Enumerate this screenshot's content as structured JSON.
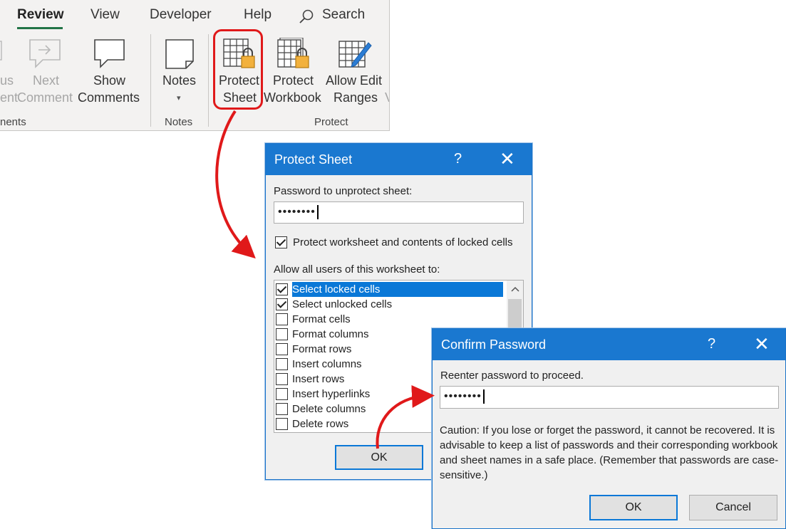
{
  "ribbon": {
    "tabs": [
      {
        "label": "Review",
        "active": true
      },
      {
        "label": "View"
      },
      {
        "label": "Developer"
      },
      {
        "label": "Help"
      }
    ],
    "search_label": "Search",
    "buttons": {
      "previous_label_1": "us",
      "previous_label_2": "ent",
      "next_label_1": "Next",
      "next_label_2": "Comment",
      "show_comments_label_1": "Show",
      "show_comments_label_2": "Comments",
      "notes_label": "Notes",
      "protect_sheet_label_1": "Protect",
      "protect_sheet_label_2": "Sheet",
      "protect_workbook_label_1": "Protect",
      "protect_workbook_label_2": "Workbook",
      "allow_edit_label_1": "Allow Edit",
      "allow_edit_label_2": "Ranges",
      "cut_off_label": "V"
    },
    "groups": {
      "comments": "nents",
      "notes": "Notes",
      "protect": "Protect"
    },
    "accent_color": "#217346"
  },
  "protect_sheet_dialog": {
    "title": "Protect Sheet",
    "help": "?",
    "close": "✕",
    "password_label": "Password to unprotect sheet:",
    "password_value": "••••••••",
    "protect_checkbox_label": "Protect worksheet and contents of locked cells",
    "protect_checkbox_checked": true,
    "allow_label": "Allow all users of this worksheet to:",
    "permissions": [
      {
        "label": "Select locked cells",
        "checked": true,
        "selected": true
      },
      {
        "label": "Select unlocked cells",
        "checked": true
      },
      {
        "label": "Format cells",
        "checked": false
      },
      {
        "label": "Format columns",
        "checked": false
      },
      {
        "label": "Format rows",
        "checked": false
      },
      {
        "label": "Insert columns",
        "checked": false
      },
      {
        "label": "Insert rows",
        "checked": false
      },
      {
        "label": "Insert hyperlinks",
        "checked": false
      },
      {
        "label": "Delete columns",
        "checked": false
      },
      {
        "label": "Delete rows",
        "checked": false
      }
    ],
    "ok_label": "OK"
  },
  "confirm_password_dialog": {
    "title": "Confirm Password",
    "help": "?",
    "close": "✕",
    "reenter_label": "Reenter password to proceed.",
    "password_value": "••••••••",
    "caution": "Caution: If you lose or forget the password, it cannot be recovered. It is advisable to keep a list of passwords and their corresponding workbook and sheet names in a safe place.  (Remember that passwords are case-sensitive.)",
    "ok_label": "OK",
    "cancel_label": "Cancel"
  },
  "colors": {
    "titlebar": "#1a78d0",
    "highlight": "#e0191a",
    "selection": "#0a78d7"
  }
}
